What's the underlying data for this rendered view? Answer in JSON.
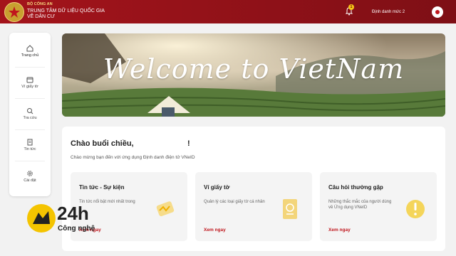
{
  "header": {
    "org_line1": "BỘ CÔNG AN",
    "org_line2": "TRUNG TÂM DỮ LIỆU QUỐC GIA",
    "org_line3": "VỀ DÂN CƯ",
    "notification_count": "1",
    "username": "Định danh mức 2"
  },
  "sidebar": {
    "items": [
      {
        "label": "Trang chủ",
        "icon": "home-icon"
      },
      {
        "label": "Ví giấy tờ",
        "icon": "wallet-icon"
      },
      {
        "label": "Tra cứu",
        "icon": "search-icon"
      },
      {
        "label": "Tin tức",
        "icon": "news-icon"
      },
      {
        "label": "Cài đặt",
        "icon": "settings-icon"
      }
    ]
  },
  "banner": {
    "text": "Welcome to VietNam"
  },
  "main": {
    "greeting": "Chào buổi chiều,",
    "greeting_end": "!",
    "subtitle": "Chào mừng bạn đến với ứng dụng Định danh điện tử VNeID",
    "tiles": [
      {
        "title": "Tin tức - Sự kiện",
        "desc": "Tin tức nổi bật mới nhất trong",
        "link": "Xem ngay",
        "icon": "megaphone-icon"
      },
      {
        "title": "Ví giấy tờ",
        "desc": "Quản lý các loại giấy tờ cá nhân",
        "link": "Xem ngay",
        "icon": "passport-icon"
      },
      {
        "title": "Câu hỏi thường gặp",
        "desc": "Những thắc mắc của người dùng về Ứng dụng VNeID",
        "link": "Xem ngay",
        "icon": "exclamation-icon"
      }
    ]
  },
  "watermark": {
    "brand_number": "24h",
    "brand_text": "Công nghệ"
  },
  "colors": {
    "header": "#a4141b",
    "accent": "#c0161d",
    "badge": "#f5c518"
  }
}
